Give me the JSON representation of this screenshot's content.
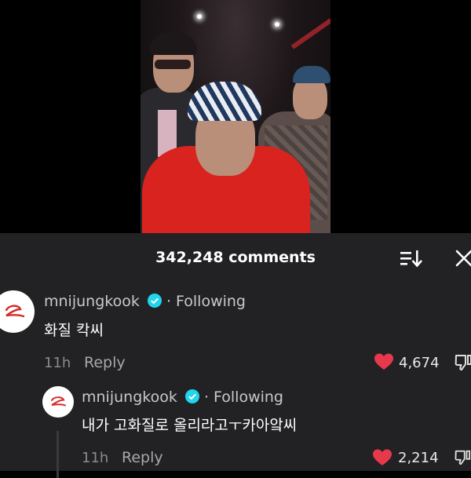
{
  "header": {
    "comments_count": "342,248 comments"
  },
  "comments": [
    {
      "username": "mnijungkook",
      "following": "· Following",
      "text": "화질 칵씨",
      "time": "11h",
      "reply": "Reply",
      "likes": "4,674"
    },
    {
      "username": "mnijungkook",
      "following": "· Following",
      "text": "내가 고화질로 올리라고ㅜ카아앜씨",
      "time": "11h",
      "reply": "Reply",
      "likes": "2,214"
    }
  ],
  "colors": {
    "sheet_bg": "#222224",
    "heart": "#e8394c",
    "verified": "#20d5ec",
    "avatar_logo": "#d42a2a"
  },
  "icons": [
    "sort-icon",
    "close-icon",
    "verified-icon",
    "heart-icon",
    "dislike-icon"
  ]
}
